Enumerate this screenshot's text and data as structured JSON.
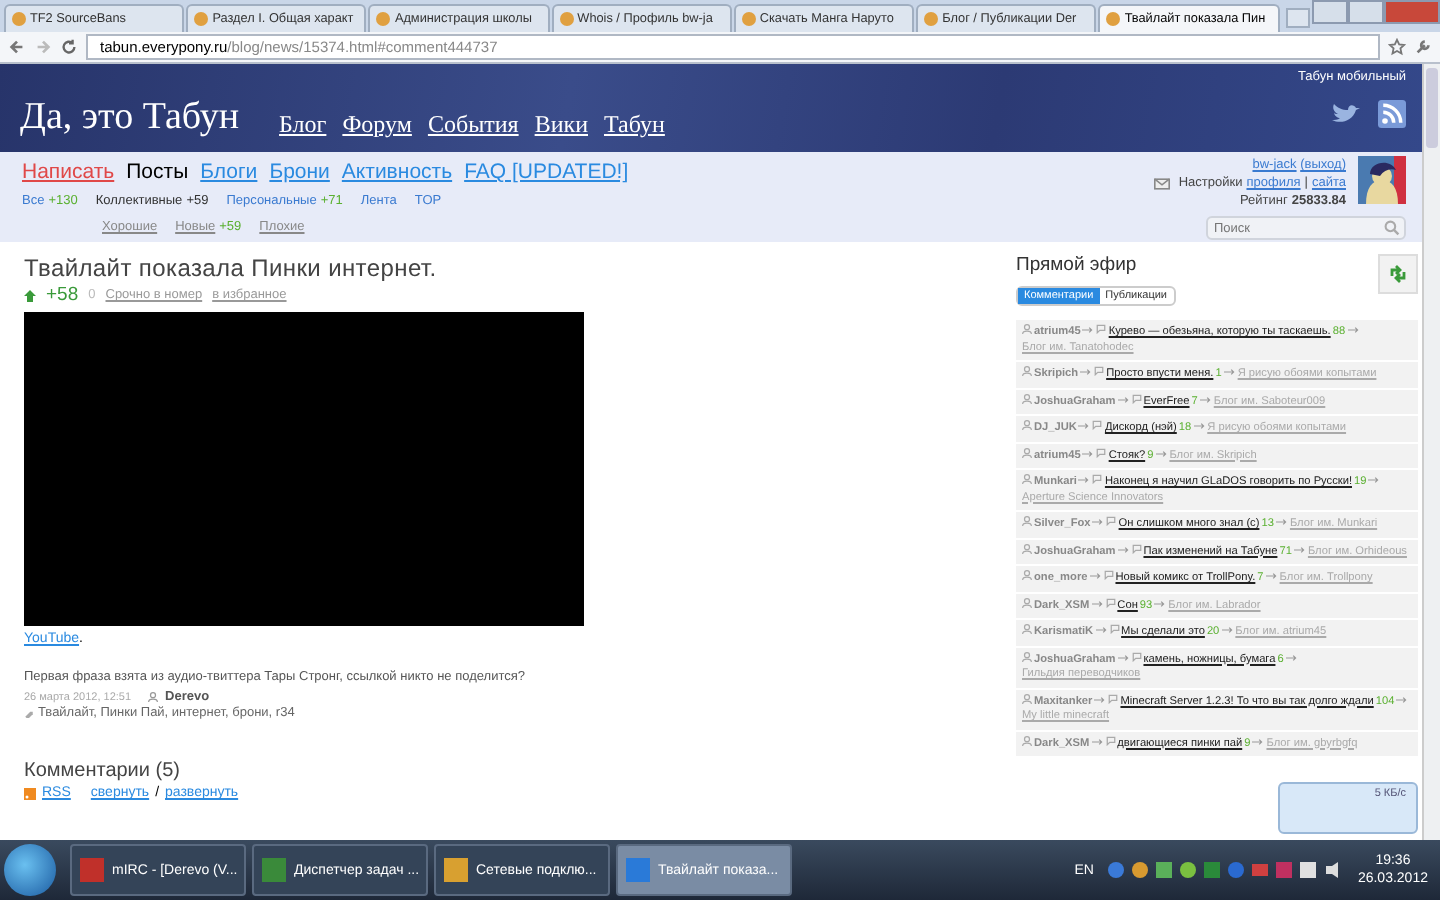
{
  "browser": {
    "tabs": [
      {
        "title": "TF2 SourceBans",
        "selected": false
      },
      {
        "title": "Раздел I. Общая характ",
        "selected": false
      },
      {
        "title": "Администрация школы",
        "selected": false
      },
      {
        "title": "Whois / Профиль bw-ja",
        "selected": false
      },
      {
        "title": "Скачать Манга Наруто",
        "selected": false
      },
      {
        "title": "Блог / Публикации Der",
        "selected": false
      },
      {
        "title": "Твайлайт показала Пин",
        "selected": true
      }
    ],
    "address": {
      "host": "tabun.everypony.ru",
      "path": "/blog/news/15374.html#comment444737"
    }
  },
  "header": {
    "site_title": "Да, это Табун",
    "nav": [
      "Блог",
      "Форум",
      "События",
      "Вики",
      "Табун"
    ],
    "mobile_link": "Табун мобильный"
  },
  "menu": [
    {
      "label": "Написать",
      "kind": "write",
      "selected": false
    },
    {
      "label": "Посты",
      "kind": "link",
      "selected": true
    },
    {
      "label": "Блоги",
      "kind": "link",
      "selected": false
    },
    {
      "label": "Брони",
      "kind": "link",
      "selected": false
    },
    {
      "label": "Активность",
      "kind": "link",
      "selected": false
    },
    {
      "label": "FAQ [UPDATED!]",
      "kind": "link",
      "selected": false
    }
  ],
  "filters": [
    {
      "label": "Все",
      "count": "+130",
      "selected": false
    },
    {
      "label": "Коллективные",
      "count": "+59",
      "selected": true
    },
    {
      "label": "Персональные",
      "count": "+71",
      "selected": false
    },
    {
      "label": "Лента",
      "selected": false
    },
    {
      "label": "TOP",
      "selected": false
    }
  ],
  "filters2": [
    {
      "label": "Хорошие"
    },
    {
      "label": "Новые",
      "count": "+59"
    },
    {
      "label": "Плохие"
    }
  ],
  "user": {
    "name": "bw-jack",
    "logout": "(выход)",
    "settings": "Настройки",
    "profile": "профиля",
    "separator": "|",
    "site": "сайта",
    "rating_label": "Рейтинг",
    "rating": "25833.84"
  },
  "search": {
    "placeholder": "Поиск"
  },
  "post": {
    "title": "Твайлайт показала Пинки интернет.",
    "score": "+58",
    "votes": "0",
    "actions": [
      "Срочно в номер",
      "в избранное"
    ],
    "link": "YouTube",
    "link_after": ".",
    "text": "Первая фраза взята из аудио-твиттера Тары Стронг, ссылкой никто не поделится?",
    "date": "26 марта 2012, 12:51",
    "author": "Derevo",
    "tags": "Твайлайт, Пинки Пай, интернет, брони, r34"
  },
  "comments": {
    "title": "Комментарии (5)",
    "rss": "RSS",
    "collapse": "свернуть",
    "separator": "/",
    "expand": "развернуть"
  },
  "live": {
    "title": "Прямой эфир",
    "tabs": [
      {
        "label": "Комментарии",
        "selected": true
      },
      {
        "label": "Публикации",
        "selected": false
      }
    ],
    "items": [
      {
        "author": "atrium45",
        "topic": "Курево — обезьяна, которую ты таскаешь.",
        "count": "88",
        "blog": "Блог им. Tanatohodec"
      },
      {
        "author": "Skripich",
        "topic": "Просто впусти меня.",
        "count": "1",
        "blog": "Я рисую обоями копытами"
      },
      {
        "author": "JoshuaGraham",
        "topic": "EverFree",
        "count": "7",
        "blog": "Блог им. Saboteur009"
      },
      {
        "author": "DJ_JUK",
        "topic": "Дискорд (нэй)",
        "count": "18",
        "blog": "Я рисую обоями копытами"
      },
      {
        "author": "atrium45",
        "topic": "Стояк?",
        "count": "9",
        "blog": "Блог им. Skripich"
      },
      {
        "author": "Munkari",
        "topic": "Наконец я научил GLaDOS говорить по Русски!",
        "count": "19",
        "blog": "Aperture Science Innovators"
      },
      {
        "author": "Silver_Fox",
        "topic": "Он слишком много знал (с)",
        "count": "13",
        "blog": "Блог им. Munkari"
      },
      {
        "author": "JoshuaGraham",
        "topic": "Пак изменений на Табуне",
        "count": "71",
        "blog": "Блог им. Orhideous"
      },
      {
        "author": "one_more",
        "topic": "Новый комикс от TrollPony.",
        "count": "7",
        "blog": "Блог им. Trollpony"
      },
      {
        "author": "Dark_XSM",
        "topic": "Сон",
        "count": "93",
        "blog": "Блог им. Labrador"
      },
      {
        "author": "KarismatiK",
        "topic": "Мы сделали это",
        "count": "20",
        "blog": "Блог им. atrium45"
      },
      {
        "author": "JoshuaGraham",
        "topic": "камень, ножницы, бумага",
        "count": "6",
        "blog": "Гильдия переводчиков"
      },
      {
        "author": "Maxitanker",
        "topic": "Minecraft Server 1.2.3! То что вы так долго ждали",
        "count": "104",
        "blog": "My little minecraft"
      },
      {
        "author": "Dark_XSM",
        "topic": "двигающиеся пинки пай",
        "count": "9",
        "blog": "Блог им. gbyrbgfq"
      }
    ]
  },
  "popup": {
    "text": "5 КБ/с"
  },
  "taskbar": {
    "items": [
      {
        "label": "mIRC - [Derevo (V...",
        "selected": false
      },
      {
        "label": "Диспетчер задач ...",
        "selected": false
      },
      {
        "label": "Сетевые подклю...",
        "selected": false
      },
      {
        "label": "Твайлайт показа...",
        "selected": true
      }
    ],
    "lang": "EN",
    "time": "19:36",
    "date": "26.03.2012"
  }
}
